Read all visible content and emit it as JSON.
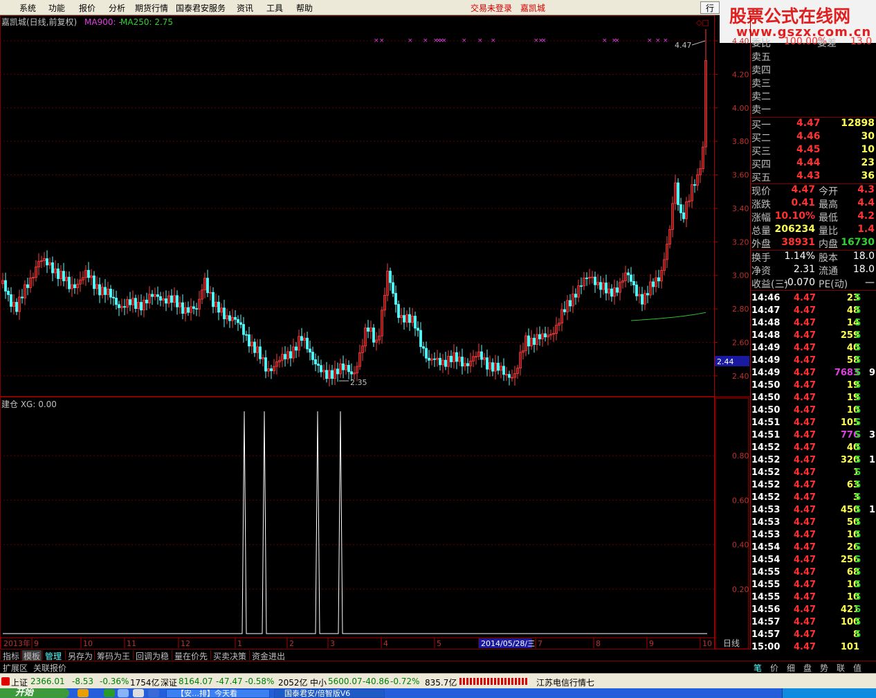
{
  "menu": {
    "items": [
      "系统",
      "功能",
      "报价",
      "分析",
      "期货行情",
      "国泰君安服务",
      "资讯",
      "工具",
      "帮助"
    ],
    "login_status": "交易未登录",
    "stock_name": "嘉凯城",
    "hq_button": "行",
    "window_controls": [
      "_",
      "□",
      "×"
    ]
  },
  "watermark": {
    "line1": "股票公式在线网",
    "line2": "www.gszx.com.cn"
  },
  "kline_header": {
    "title": "嘉凯城(日线,前复权)",
    "ma900": "MA900: -",
    "ma250": "MA250: 2.75",
    "corner_icons": "◇□"
  },
  "kline_axis": {
    "ticks": [
      "4.40",
      "4.20",
      "4.00",
      "3.80",
      "3.60",
      "3.40",
      "3.20",
      "3.00",
      "2.80",
      "2.60",
      "2.40"
    ],
    "current_price_tag": "2.44",
    "high_label": "4.47",
    "low_label": "2.35"
  },
  "indicator": {
    "header": "建仓 XG: 0.00",
    "ticks": [
      "0.80",
      "0.60",
      "0.40",
      "0.20"
    ]
  },
  "date_axis": {
    "labels": [
      "2013年",
      "9",
      "10",
      "11",
      "12",
      "1",
      "2",
      "3",
      "4",
      "5",
      "2014/05/28/三",
      "7",
      "8",
      "9",
      "10"
    ],
    "period": "日线",
    "zoom": [
      "+",
      "-",
      "0"
    ]
  },
  "chart_data": {
    "type": "candlestick",
    "title": "嘉凯城(日线,前复权)",
    "high": 4.47,
    "low": 2.35,
    "last_close": 4.47,
    "yrange": [
      2.3,
      4.52
    ],
    "ma250_last": 2.75,
    "indicator_name": "建仓 XG",
    "indicator_range": [
      0,
      1
    ],
    "signal_spikes": 4
  },
  "bottom_tabs": [
    "指标",
    "模板",
    "管理",
    "另存为",
    "筹码为王",
    "回调为稳",
    "量在价先",
    "买卖决策",
    "资金进出"
  ],
  "ext_tabs": [
    "扩展区",
    "关联报价"
  ],
  "quote": {
    "header": {
      "label1": "委比",
      "val1": "100.00%",
      "label2": "委差",
      "val2": "13.0"
    },
    "sell": [
      {
        "label": "卖五"
      },
      {
        "label": "卖四"
      },
      {
        "label": "卖三"
      },
      {
        "label": "卖二"
      },
      {
        "label": "卖一"
      }
    ],
    "buy": [
      {
        "label": "买一",
        "price": "4.47",
        "vol": "12898"
      },
      {
        "label": "买二",
        "price": "4.46",
        "vol": "30"
      },
      {
        "label": "买三",
        "price": "4.45",
        "vol": "10"
      },
      {
        "label": "买四",
        "price": "4.44",
        "vol": "23"
      },
      {
        "label": "买五",
        "price": "4.43",
        "vol": "36"
      }
    ],
    "stats": [
      {
        "l1": "现价",
        "v1": "4.47",
        "l2": "今开",
        "v2": "4.3"
      },
      {
        "l1": "涨跌",
        "v1": "0.41",
        "l2": "最高",
        "v2": "4.4"
      },
      {
        "l1": "涨幅",
        "v1": "10.10%",
        "l2": "最低",
        "v2": "4.2"
      },
      {
        "l1": "总量",
        "v1": "206234",
        "l2": "量比",
        "v2": "1.4"
      },
      {
        "l1": "外盘",
        "v1": "38931",
        "l2": "内盘",
        "v2": "16730"
      }
    ],
    "stats2": [
      {
        "l1": "换手",
        "v1": "1.14%",
        "l2": "股本",
        "v2": "18.0"
      },
      {
        "l1": "净资",
        "v1": "2.31",
        "l2": "流通",
        "v2": "18.0"
      },
      {
        "l1": "收益(三)",
        "v1": "-0.070",
        "l2": "PE(动)",
        "v2": "—"
      }
    ],
    "ticks": [
      {
        "t": "14:46",
        "p": "4.47",
        "v": "23",
        "s": "S",
        "x": ""
      },
      {
        "t": "14:47",
        "p": "4.47",
        "v": "48",
        "s": "S",
        "x": ""
      },
      {
        "t": "14:48",
        "p": "4.47",
        "v": "14",
        "s": "S",
        "x": ""
      },
      {
        "t": "14:48",
        "p": "4.47",
        "v": "259",
        "s": "S",
        "x": ""
      },
      {
        "t": "14:49",
        "p": "4.47",
        "v": "40",
        "s": "S",
        "x": ""
      },
      {
        "t": "14:49",
        "p": "4.47",
        "v": "58",
        "s": "S",
        "x": ""
      },
      {
        "t": "14:49",
        "p": "4.47",
        "v": "7683",
        "s": "S",
        "x": "9"
      },
      {
        "t": "14:50",
        "p": "4.47",
        "v": "19",
        "s": "S",
        "x": ""
      },
      {
        "t": "14:50",
        "p": "4.47",
        "v": "19",
        "s": "S",
        "x": ""
      },
      {
        "t": "14:50",
        "p": "4.47",
        "v": "10",
        "s": "S",
        "x": ""
      },
      {
        "t": "14:51",
        "p": "4.47",
        "v": "105",
        "s": "S",
        "x": ""
      },
      {
        "t": "14:51",
        "p": "4.47",
        "v": "776",
        "s": "S",
        "x": "3"
      },
      {
        "t": "14:52",
        "p": "4.47",
        "v": "40",
        "s": "S",
        "x": ""
      },
      {
        "t": "14:52",
        "p": "4.47",
        "v": "320",
        "s": "S",
        "x": "1"
      },
      {
        "t": "14:52",
        "p": "4.47",
        "v": "1",
        "s": "S",
        "x": ""
      },
      {
        "t": "14:52",
        "p": "4.47",
        "v": "63",
        "s": "S",
        "x": ""
      },
      {
        "t": "14:52",
        "p": "4.47",
        "v": "3",
        "s": "S",
        "x": ""
      },
      {
        "t": "14:53",
        "p": "4.47",
        "v": "450",
        "s": "S",
        "x": "1"
      },
      {
        "t": "14:53",
        "p": "4.47",
        "v": "50",
        "s": "S",
        "x": ""
      },
      {
        "t": "14:53",
        "p": "4.47",
        "v": "10",
        "s": "S",
        "x": ""
      },
      {
        "t": "14:54",
        "p": "4.47",
        "v": "26",
        "s": "S",
        "x": ""
      },
      {
        "t": "14:54",
        "p": "4.47",
        "v": "256",
        "s": "S",
        "x": ""
      },
      {
        "t": "14:55",
        "p": "4.47",
        "v": "68",
        "s": "S",
        "x": ""
      },
      {
        "t": "14:55",
        "p": "4.47",
        "v": "10",
        "s": "S",
        "x": ""
      },
      {
        "t": "14:55",
        "p": "4.47",
        "v": "10",
        "s": "S",
        "x": ""
      },
      {
        "t": "14:56",
        "p": "4.47",
        "v": "421",
        "s": "S",
        "x": ""
      },
      {
        "t": "14:57",
        "p": "4.47",
        "v": "100",
        "s": "S",
        "x": ""
      },
      {
        "t": "14:57",
        "p": "4.47",
        "v": "8",
        "s": "S",
        "x": ""
      },
      {
        "t": "15:00",
        "p": "4.47",
        "v": "101",
        "s": "",
        "x": ""
      }
    ],
    "tabs": [
      "笔",
      "价",
      "细",
      "盘",
      "势",
      "联",
      "值"
    ]
  },
  "statusbar": {
    "sh_label": "上证",
    "sh_val": "2366.01",
    "sh_chg": "-8.53",
    "sh_pct": "-0.36%",
    "sh_amt": "1754亿",
    "sz_label": "深证",
    "sz_val": "8164.07",
    "sz_chg": "-47.47",
    "sz_pct": "-0.58%",
    "sz_amt": "2052亿",
    "zx_label": "中小",
    "zx_val": "5600.07",
    "zx_chg": "-40.86",
    "zx_pct": "-0.72%",
    "zx_amt": "835.7亿",
    "server": "江苏电信行情七"
  },
  "taskbar": {
    "start": "开始",
    "task1": "【安…排】今天看",
    "task2": "国泰君安/倍智版V6"
  }
}
